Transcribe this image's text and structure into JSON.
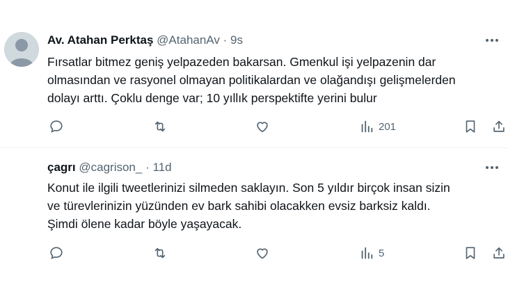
{
  "tweets": [
    {
      "author_name": "Av. Atahan Perktaş",
      "handle": "@AtahanAv",
      "separator": "·",
      "time": "9s",
      "text_lines": [
        "Fırsatlar bitmez geniş yelpazeden bakarsan. Gmenkul işi yelpazenin dar",
        "olmasından ve rasyonel olmayan politikalardan ve olağandışı gelişmelerden",
        "dolayı arttı. Çoklu denge var; 10 yıllık perspektifte yerini bulur"
      ],
      "views": "201",
      "icons": [
        "reply-icon",
        "retweet-icon",
        "like-icon",
        "views-icon",
        "bookmark-icon",
        "share-icon",
        "more-icon"
      ]
    },
    {
      "author_name": "çagrı",
      "handle": "@cagrison_",
      "separator": "·",
      "time": "11d",
      "text_lines": [
        "Konut ile ilgili tweetlerinizi silmeden saklayın. Son 5 yıldır birçok insan sizin",
        "ve türevlerinizin yüzünden ev bark sahibi olacakken evsiz barksiz kaldı.",
        "Şimdi ölene kadar böyle yaşayacak."
      ],
      "views": "5",
      "icons": [
        "reply-icon",
        "retweet-icon",
        "like-icon",
        "views-icon",
        "bookmark-icon",
        "share-icon",
        "more-icon"
      ]
    }
  ],
  "colors": {
    "text": "#0f1419",
    "secondary": "#536471",
    "divider": "#eff3f4",
    "avatar": "#cfd9de"
  }
}
